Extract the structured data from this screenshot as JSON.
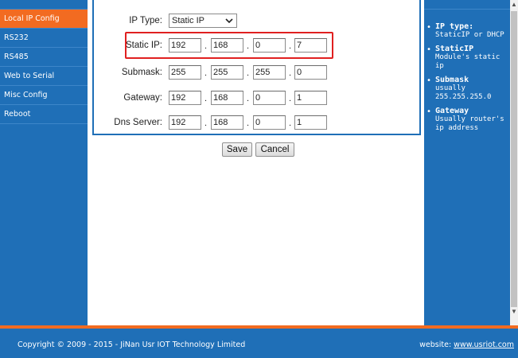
{
  "sidebar": {
    "items": [
      {
        "label": "Local IP Config",
        "active": true
      },
      {
        "label": "RS232"
      },
      {
        "label": "RS485"
      },
      {
        "label": "Web to Serial"
      },
      {
        "label": "Misc Config"
      },
      {
        "label": "Reboot"
      }
    ]
  },
  "form": {
    "ip_type": {
      "label": "IP Type:",
      "value": "Static IP"
    },
    "static_ip": {
      "label": "Static IP:",
      "octets": [
        "192",
        "168",
        "0",
        "7"
      ]
    },
    "submask": {
      "label": "Submask:",
      "octets": [
        "255",
        "255",
        "255",
        "0"
      ]
    },
    "gateway": {
      "label": "Gateway:",
      "octets": [
        "192",
        "168",
        "0",
        "1"
      ]
    },
    "dns": {
      "label": "Dns Server:",
      "octets": [
        "192",
        "168",
        "0",
        "1"
      ]
    },
    "separator": "."
  },
  "buttons": {
    "save": "Save",
    "cancel": "Cancel"
  },
  "help": [
    {
      "title": "IP type:",
      "desc": "StaticIP or DHCP"
    },
    {
      "title": "StaticIP",
      "desc": "Module's static ip"
    },
    {
      "title": "Submask",
      "desc": "usually 255.255.255.0"
    },
    {
      "title": "Gateway",
      "desc": "Usually router's ip address"
    }
  ],
  "footer": {
    "copyright": "Copyright © 2009 - 2015 - JiNan Usr IOT Technology Limited",
    "website_label": "website: ",
    "website_link": "www.usriot.com"
  },
  "colors": {
    "primary": "#1f6fb7",
    "accent": "#f26b21",
    "highlight": "#e02020"
  },
  "icons": {
    "bullet": "•",
    "scroll_up": "▲",
    "scroll_down": "▼"
  }
}
